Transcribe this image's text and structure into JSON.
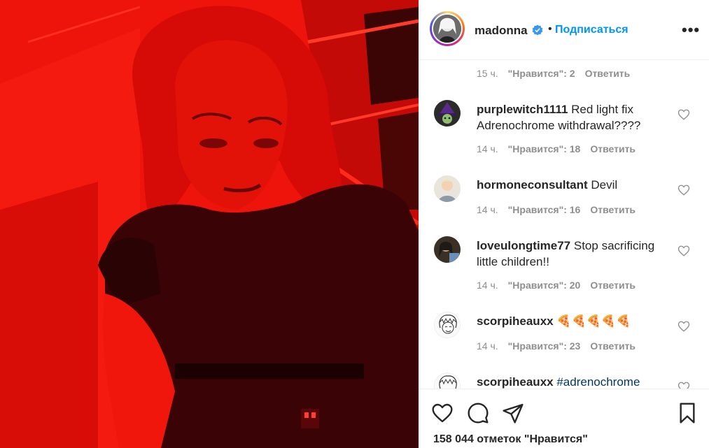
{
  "post": {
    "username": "madonna",
    "separator": "•",
    "follow_label": "Подписаться",
    "more_label": "•••"
  },
  "comments": [
    {
      "partial": true,
      "time": "15 ч.",
      "likes": "\"Нравится\": 2",
      "reply": "Ответить"
    },
    {
      "user": "purplewitch1111",
      "text": "Red light fix Adrenochrome withdrawal????",
      "time": "14 ч.",
      "likes": "\"Нравится\": 18",
      "reply": "Ответить"
    },
    {
      "user": "hormoneconsultant",
      "text": "Devil",
      "time": "14 ч.",
      "likes": "\"Нравится\": 16",
      "reply": "Ответить"
    },
    {
      "user": "loveulongtime77",
      "text": "Stop sacrificing little children!!",
      "time": "14 ч.",
      "likes": "\"Нравится\": 20",
      "reply": "Ответить"
    },
    {
      "user": "scorpiheauxx",
      "text": "🍕🍕🍕🍕🍕",
      "time": "14 ч.",
      "likes": "\"Нравится\": 23",
      "reply": "Ответить"
    },
    {
      "user": "scorpiheauxx",
      "text": "#adrenochrome"
    }
  ],
  "footer": {
    "likes_count": "158 044 отметок \"Нравится\""
  },
  "icons": {
    "verified": "verified-badge-icon",
    "like": "heart-icon",
    "comment": "comment-icon",
    "share": "paper-plane-icon",
    "save": "bookmark-icon"
  },
  "colors": {
    "accent": "#0095f6",
    "photo_red": "#e8100a",
    "muted": "#8e8e8e"
  }
}
